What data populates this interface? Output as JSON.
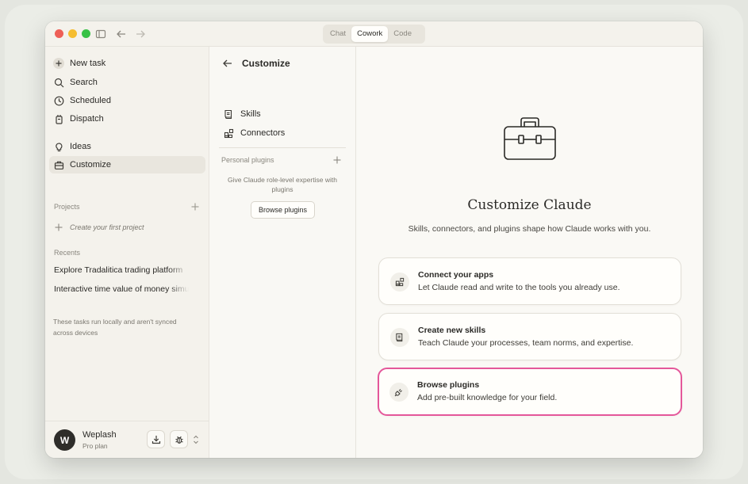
{
  "titlebar": {
    "tabs": [
      {
        "label": "Chat",
        "active": false
      },
      {
        "label": "Cowork",
        "active": true
      },
      {
        "label": "Code",
        "active": false
      }
    ]
  },
  "sidebar": {
    "primary": [
      {
        "label": "New task",
        "icon": "plus-icon"
      },
      {
        "label": "Search",
        "icon": "search-icon"
      },
      {
        "label": "Scheduled",
        "icon": "clock-icon"
      },
      {
        "label": "Dispatch",
        "icon": "dispatch-icon"
      }
    ],
    "secondary": [
      {
        "label": "Ideas",
        "icon": "lightbulb-icon"
      },
      {
        "label": "Customize",
        "icon": "briefcase-icon",
        "active": true
      }
    ],
    "projects_label": "Projects",
    "create_project": "Create your first project",
    "recents_label": "Recents",
    "recents": [
      "Explore Tradalitica trading platform",
      "Interactive time value of money simulator"
    ],
    "note": "These tasks run locally and aren't synced across devices",
    "user": {
      "initial": "W",
      "name": "Weplash",
      "plan": "Pro plan"
    }
  },
  "panel": {
    "title": "Customize",
    "items": [
      {
        "label": "Skills",
        "icon": "skills-icon"
      },
      {
        "label": "Connectors",
        "icon": "connectors-icon"
      }
    ],
    "personal_plugins_label": "Personal plugins",
    "personal_plugins_desc": "Give Claude role-level expertise with plugins",
    "browse_button": "Browse plugins"
  },
  "main": {
    "title": "Customize Claude",
    "subtitle": "Skills, connectors, and plugins shape how Claude works with you.",
    "cards": [
      {
        "title": "Connect your apps",
        "desc": "Let Claude read and write to the tools you already use.",
        "icon": "connectors-icon"
      },
      {
        "title": "Create new skills",
        "desc": "Teach Claude your processes, team norms, and expertise.",
        "icon": "skills-icon"
      },
      {
        "title": "Browse plugins",
        "desc": "Add pre-built knowledge for your field.",
        "icon": "plug-icon",
        "highlighted": true
      }
    ],
    "highlight_color": "#e4579a"
  }
}
